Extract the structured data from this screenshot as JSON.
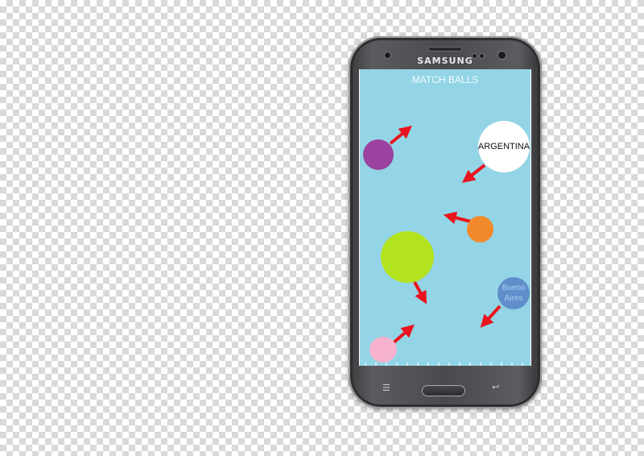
{
  "device": {
    "brand": "SAMSUNG",
    "menu_icon": "menu-icon",
    "back_icon": "back-icon",
    "menu_glyph": "☰",
    "back_glyph": "↩"
  },
  "game": {
    "title": "MATCH BALLS",
    "background_color": "#93d5e6",
    "arrow_color": "#e8141e",
    "balls": [
      {
        "name": "ball-purple",
        "color": "#9b41a0",
        "label": ""
      },
      {
        "name": "ball-argentina",
        "color": "#ffffff",
        "label": "ARGENTINA"
      },
      {
        "name": "ball-orange",
        "color": "#f28a2c",
        "label": ""
      },
      {
        "name": "ball-lime",
        "color": "#b3e21f",
        "label": ""
      },
      {
        "name": "ball-buenos-aires",
        "color": "#5f8ecb",
        "label": "Bueno Aires"
      },
      {
        "name": "ball-pink",
        "color": "#f7b2cf",
        "label": ""
      }
    ]
  }
}
